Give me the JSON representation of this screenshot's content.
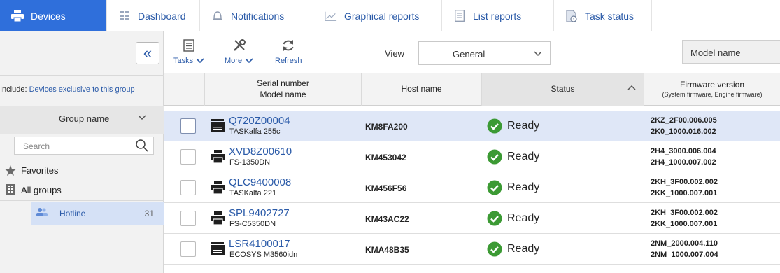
{
  "tabs": [
    {
      "label": "Devices",
      "icon": "printer-icon",
      "active": true
    },
    {
      "label": "Dashboard",
      "icon": "dashboard-icon",
      "active": false
    },
    {
      "label": "Notifications",
      "icon": "bell-icon",
      "active": false
    },
    {
      "label": "Graphical reports",
      "icon": "chart-icon",
      "active": false
    },
    {
      "label": "List reports",
      "icon": "list-icon",
      "active": false
    },
    {
      "label": "Task status",
      "icon": "task-icon",
      "active": false
    }
  ],
  "sidebar": {
    "collapse_icon": "double-chevron-left-icon",
    "include_label": "Include:",
    "include_link": "Devices exclusive to this group",
    "group_header": "Group name",
    "search_placeholder": "Search",
    "favorites": "Favorites",
    "all_groups": "All groups",
    "group": {
      "name": "Hotline",
      "count": "31"
    }
  },
  "toolbar": {
    "tasks": "Tasks",
    "more": "More",
    "refresh": "Refresh",
    "view_label": "View",
    "view_value": "General",
    "model_name_button": "Model name"
  },
  "table": {
    "columns": {
      "serial": "Serial number",
      "model": "Model name",
      "host": "Host name",
      "status": "Status",
      "firmware": "Firmware version",
      "firmware_sub": "(System firmware, Engine firmware)"
    },
    "rows": [
      {
        "serial": "Q720Z00004",
        "model": "TASKalfa 255c",
        "host": "KM8FA200",
        "status": "Ready",
        "fw1": "2KZ_2F00.006.005",
        "fw2": "2K0_1000.016.002",
        "selected": true,
        "device": "mfp"
      },
      {
        "serial": "XVD8Z00610",
        "model": "FS-1350DN",
        "host": "KM453042",
        "status": "Ready",
        "fw1": "2H4_3000.006.004",
        "fw2": "2H4_1000.007.002",
        "selected": false,
        "device": "printer"
      },
      {
        "serial": "QLC9400008",
        "model": "TASKalfa 221",
        "host": "KM456F56",
        "status": "Ready",
        "fw1": "2KH_3F00.002.002",
        "fw2": "2KK_1000.007.001",
        "selected": false,
        "device": "printer"
      },
      {
        "serial": "SPL9402727",
        "model": "FS-C5350DN",
        "host": "KM43AC22",
        "status": "Ready",
        "fw1": "2KH_3F00.002.002",
        "fw2": "2KK_1000.007.001",
        "selected": false,
        "device": "printer"
      },
      {
        "serial": "LSR4100017",
        "model": "ECOSYS M3560idn",
        "host": "KMA48B35",
        "status": "Ready",
        "fw1": "2NM_2000.004.110",
        "fw2": "2NM_1000.007.004",
        "selected": false,
        "device": "mfp"
      }
    ]
  },
  "colors": {
    "accent": "#2f6fdb",
    "link": "#2a5aa8",
    "ready": "#3c9a34",
    "selected_row": "#dfe7f7"
  }
}
